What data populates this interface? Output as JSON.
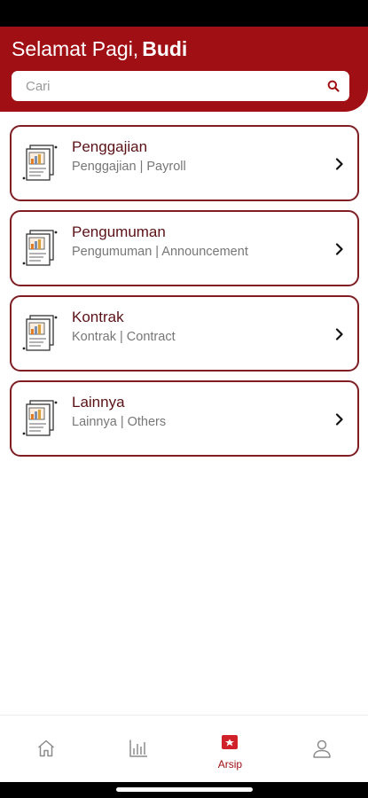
{
  "header": {
    "greeting": "Selamat Pagi,",
    "user_name": "Budi"
  },
  "search": {
    "placeholder": "Cari",
    "icon": "search-icon"
  },
  "categories": [
    {
      "title": "Penggajian",
      "subtitle": "Penggajian | Payroll",
      "icon": "document-chart-icon"
    },
    {
      "title": "Pengumuman",
      "subtitle": "Pengumuman | Announcement",
      "icon": "document-chart-icon"
    },
    {
      "title": "Kontrak",
      "subtitle": "Kontrak | Contract",
      "icon": "document-chart-icon"
    },
    {
      "title": "Lainnya",
      "subtitle": "Lainnya | Others",
      "icon": "document-chart-icon"
    }
  ],
  "tabbar": {
    "items": [
      {
        "icon": "home-icon",
        "label": "",
        "active": false
      },
      {
        "icon": "chart-icon",
        "label": "",
        "active": false
      },
      {
        "icon": "archive-icon",
        "label": "Arsip",
        "active": true
      },
      {
        "icon": "profile-icon",
        "label": "",
        "active": false
      }
    ]
  },
  "colors": {
    "brand": "#a00f14",
    "card_border": "#7e1d22",
    "title_text": "#5b1216",
    "subtitle_text": "#777777",
    "inactive_icon": "#8c8c8c"
  }
}
